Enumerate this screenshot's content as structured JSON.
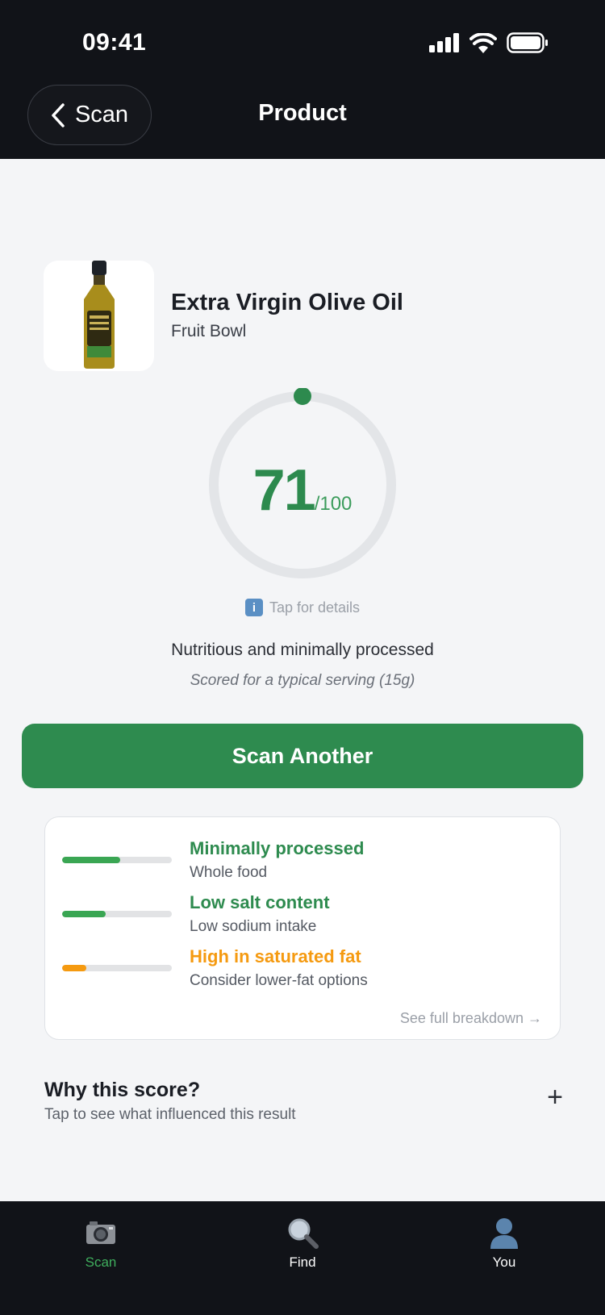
{
  "status_bar": {
    "time": "09:41"
  },
  "header": {
    "back_label": "Scan",
    "title": "Product"
  },
  "product": {
    "name": "Extra Virgin Olive Oil",
    "brand": "Fruit Bowl"
  },
  "score": {
    "value": "71",
    "max_label": "/100",
    "fraction": 0.71,
    "details_label": "Tap for details",
    "verdict": "Nutritious and minimally processed",
    "serving_note": "Scored for a typical serving (15g)",
    "color": "#2d8a4e"
  },
  "scan_another_label": "Scan Another",
  "breakdown": {
    "factors": [
      {
        "title": "Minimally processed",
        "subtitle": "Whole food",
        "level": 0.53,
        "color": "#3aa653"
      },
      {
        "title": "Low salt content",
        "subtitle": "Low sodium intake",
        "level": 0.4,
        "color": "#3aa653"
      },
      {
        "title": "High in saturated fat",
        "subtitle": "Consider lower-fat options",
        "level": 0.22,
        "color": "#f59a10"
      }
    ],
    "see_full_label": "See full breakdown →"
  },
  "why": {
    "title": "Why this score?",
    "subtitle": "Tap to see what influenced this result",
    "expand_icon": "+"
  },
  "tabs": [
    {
      "label": "Scan",
      "icon": "camera-icon",
      "active": true
    },
    {
      "label": "Find",
      "icon": "magnifier-icon",
      "active": false
    },
    {
      "label": "You",
      "icon": "user-icon",
      "active": false
    }
  ],
  "colors": {
    "accent": "#2e8b4f",
    "warning": "#f59a10",
    "dark": "#111318"
  }
}
